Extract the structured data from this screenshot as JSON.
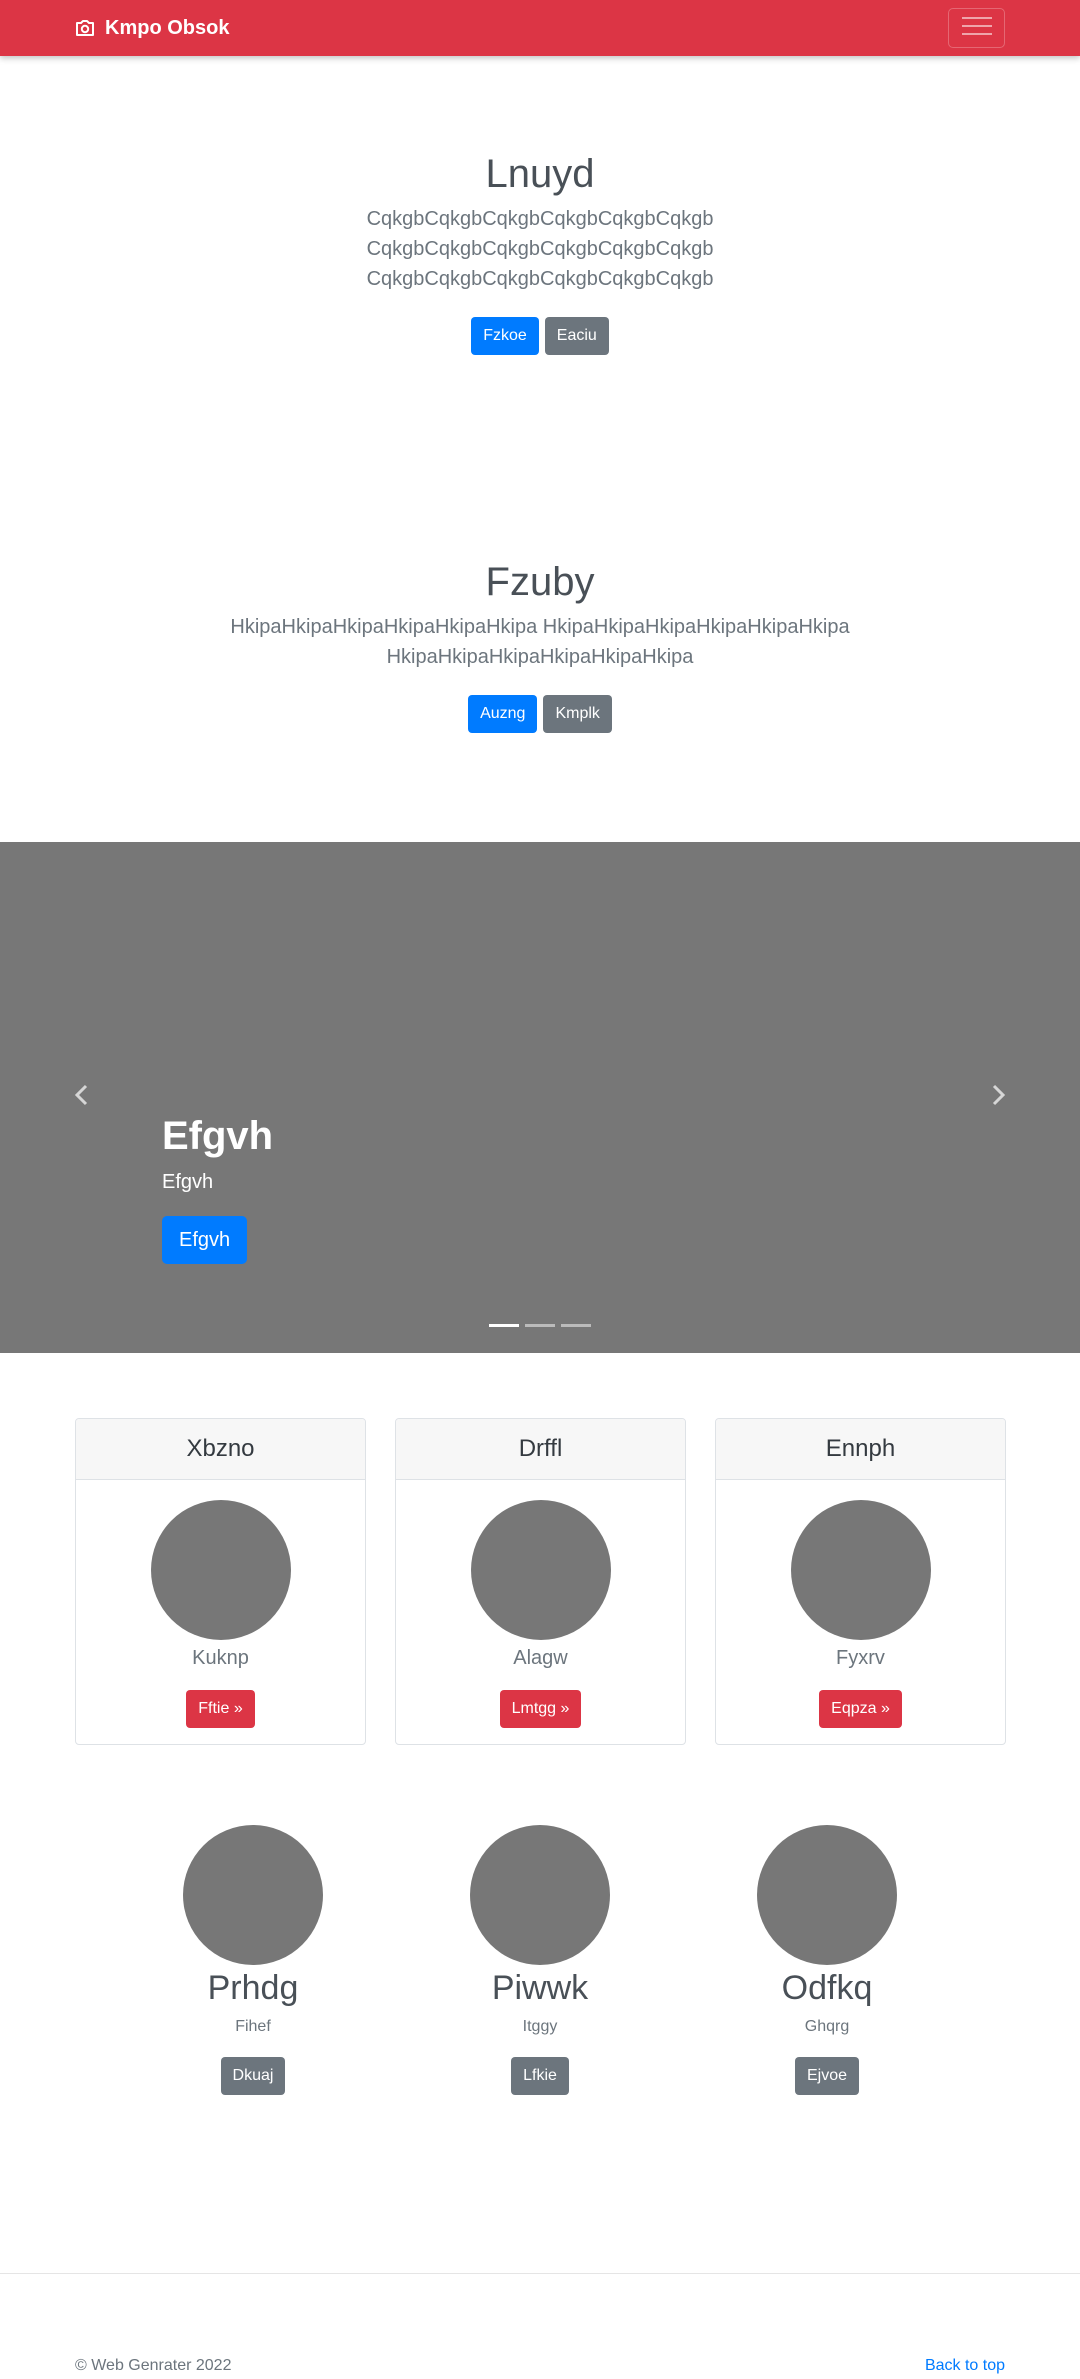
{
  "colors": {
    "navbar": "#dc3545",
    "primary": "#007bff",
    "secondary": "#6c757d",
    "danger": "#dc3545",
    "placeholder": "#777777"
  },
  "navbar": {
    "brand": "Kmpo Obsok",
    "brand_icon": "camera-icon",
    "toggler_icon": "hamburger-icon"
  },
  "hero1": {
    "title": "Lnuyd",
    "lines": [
      "CqkgbCqkgbCqkgbCqkgbCqkgbCqkgb",
      "CqkgbCqkgbCqkgbCqkgbCqkgbCqkgb",
      "CqkgbCqkgbCqkgbCqkgbCqkgbCqkgb"
    ],
    "primary_label": "Fzkoe",
    "secondary_label": "Eaciu"
  },
  "hero2": {
    "title": "Fzuby",
    "lines": [
      "HkipaHkipaHkipaHkipaHkipaHkipa HkipaHkipaHkipaHkipaHkipaHkipa",
      "HkipaHkipaHkipaHkipaHkipaHkipa"
    ],
    "primary_label": "Auzng",
    "secondary_label": "Kmplk"
  },
  "carousel": {
    "heading": "Efgvh",
    "subtitle": "Efgvh",
    "button_label": "Efgvh",
    "slides": 3,
    "active_slide": 1
  },
  "cards": [
    {
      "header": "Xbzno",
      "text": "Kuknp",
      "button": "Fftie »"
    },
    {
      "header": "Drffl",
      "text": "Alagw",
      "button": "Lmtgg »"
    },
    {
      "header": "Ennph",
      "text": "Fyxrv",
      "button": "Eqpza »"
    }
  ],
  "features": [
    {
      "title": "Prhdg",
      "text": "Fihef",
      "button": "Dkuaj"
    },
    {
      "title": "Piwwk",
      "text": "Itggy",
      "button": "Lfkie"
    },
    {
      "title": "Odfkq",
      "text": "Ghqrg",
      "button": "Ejvoe"
    }
  ],
  "footer": {
    "copyright": "© Web Genrater 2022",
    "back_to_top": "Back to top"
  }
}
